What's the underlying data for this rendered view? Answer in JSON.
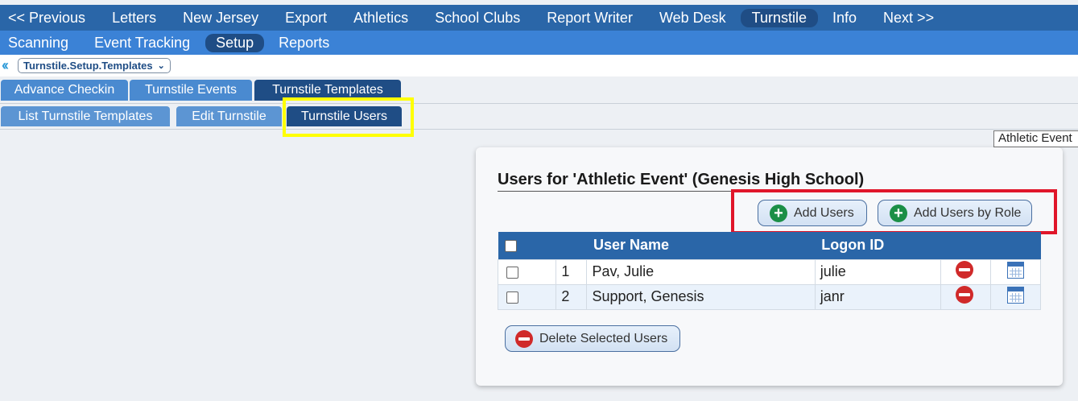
{
  "topnav": {
    "items": [
      "<< Previous",
      "Letters",
      "New Jersey",
      "Export",
      "Athletics",
      "School Clubs",
      "Report Writer",
      "Web Desk",
      "Turnstile",
      "Info",
      "Next >>"
    ],
    "active": "Turnstile"
  },
  "subnav": {
    "items": [
      "Scanning",
      "Event Tracking",
      "Setup",
      "Reports"
    ],
    "active": "Setup"
  },
  "breadcrumb": {
    "back_icon": "double-chevron-left-icon",
    "label": "Turnstile.Setup.Templates"
  },
  "tabs_level1": [
    "Advance Checkin",
    "Turnstile Events",
    "Turnstile Templates"
  ],
  "tabs_level2": [
    "List Turnstile Templates",
    "Edit Turnstile",
    "Turnstile Users"
  ],
  "tooltip": "Athletic Event",
  "panel": {
    "title": "Users for 'Athletic Event' (Genesis High School)",
    "add_users_label": "Add Users",
    "add_by_role_label": "Add Users by Role",
    "delete_selected_label": "Delete Selected Users"
  },
  "table": {
    "columns": [
      "",
      "",
      "User Name",
      "Logon ID",
      "",
      ""
    ],
    "rows": [
      {
        "num": "1",
        "name": "Pav, Julie",
        "logon": "julie"
      },
      {
        "num": "2",
        "name": "Support, Genesis",
        "logon": "janr"
      }
    ]
  },
  "colors": {
    "nav_dark": "#2a66a8",
    "nav_light": "#3b82d6",
    "active": "#1f4d85",
    "highlight_yellow": "#ffff00",
    "highlight_red": "#e0162a"
  }
}
